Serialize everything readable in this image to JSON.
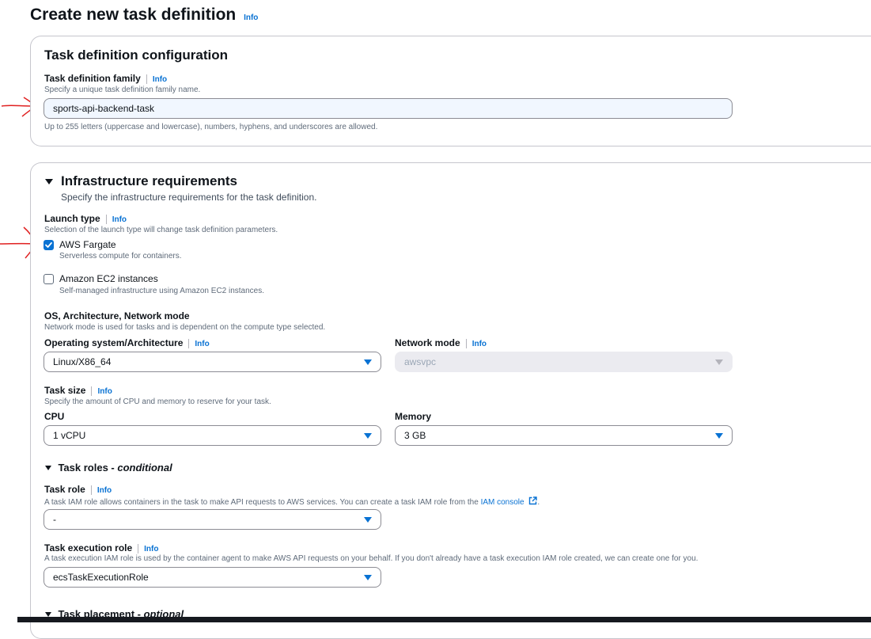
{
  "page": {
    "title": "Create new task definition",
    "info_label": "Info"
  },
  "config": {
    "title": "Task definition configuration",
    "family_label": "Task definition family",
    "family_desc": "Specify a unique task definition family name.",
    "family_value": "sports-api-backend-task",
    "family_constraint": "Up to 255 letters (uppercase and lowercase), numbers, hyphens, and underscores are allowed."
  },
  "infra": {
    "title": "Infrastructure requirements",
    "subtitle": "Specify the infrastructure requirements for the task definition.",
    "launch_type_label": "Launch type",
    "launch_type_desc": "Selection of the launch type will change task definition parameters.",
    "fargate_label": "AWS Fargate",
    "fargate_desc": "Serverless compute for containers.",
    "fargate_checked": true,
    "ec2_label": "Amazon EC2 instances",
    "ec2_desc": "Self-managed infrastructure using Amazon EC2 instances.",
    "ec2_checked": false,
    "os_group_label": "OS, Architecture, Network mode",
    "os_group_desc": "Network mode is used for tasks and is dependent on the compute type selected.",
    "os_label": "Operating system/Architecture",
    "os_value": "Linux/X86_64",
    "network_label": "Network mode",
    "network_value": "awsvpc",
    "task_size_label": "Task size",
    "task_size_desc": "Specify the amount of CPU and memory to reserve for your task.",
    "cpu_label": "CPU",
    "cpu_value": "1 vCPU",
    "memory_label": "Memory",
    "memory_value": "3 GB"
  },
  "roles": {
    "title": "Task roles - ",
    "title_suffix": "conditional",
    "task_role_label": "Task role",
    "task_role_desc_prefix": "A task IAM role allows containers in the task to make API requests to AWS services. You can create a task IAM role from the ",
    "task_role_link": "IAM console",
    "task_role_desc_suffix": ".",
    "task_role_value": "-",
    "exec_role_label": "Task execution role",
    "exec_role_desc": "A task execution IAM role is used by the container agent to make AWS API requests on your behalf. If you don't already have a task execution IAM role created, we can create one for you.",
    "exec_role_value": "ecsTaskExecutionRole"
  },
  "placement": {
    "title": "Task placement - ",
    "title_suffix": "optional"
  }
}
